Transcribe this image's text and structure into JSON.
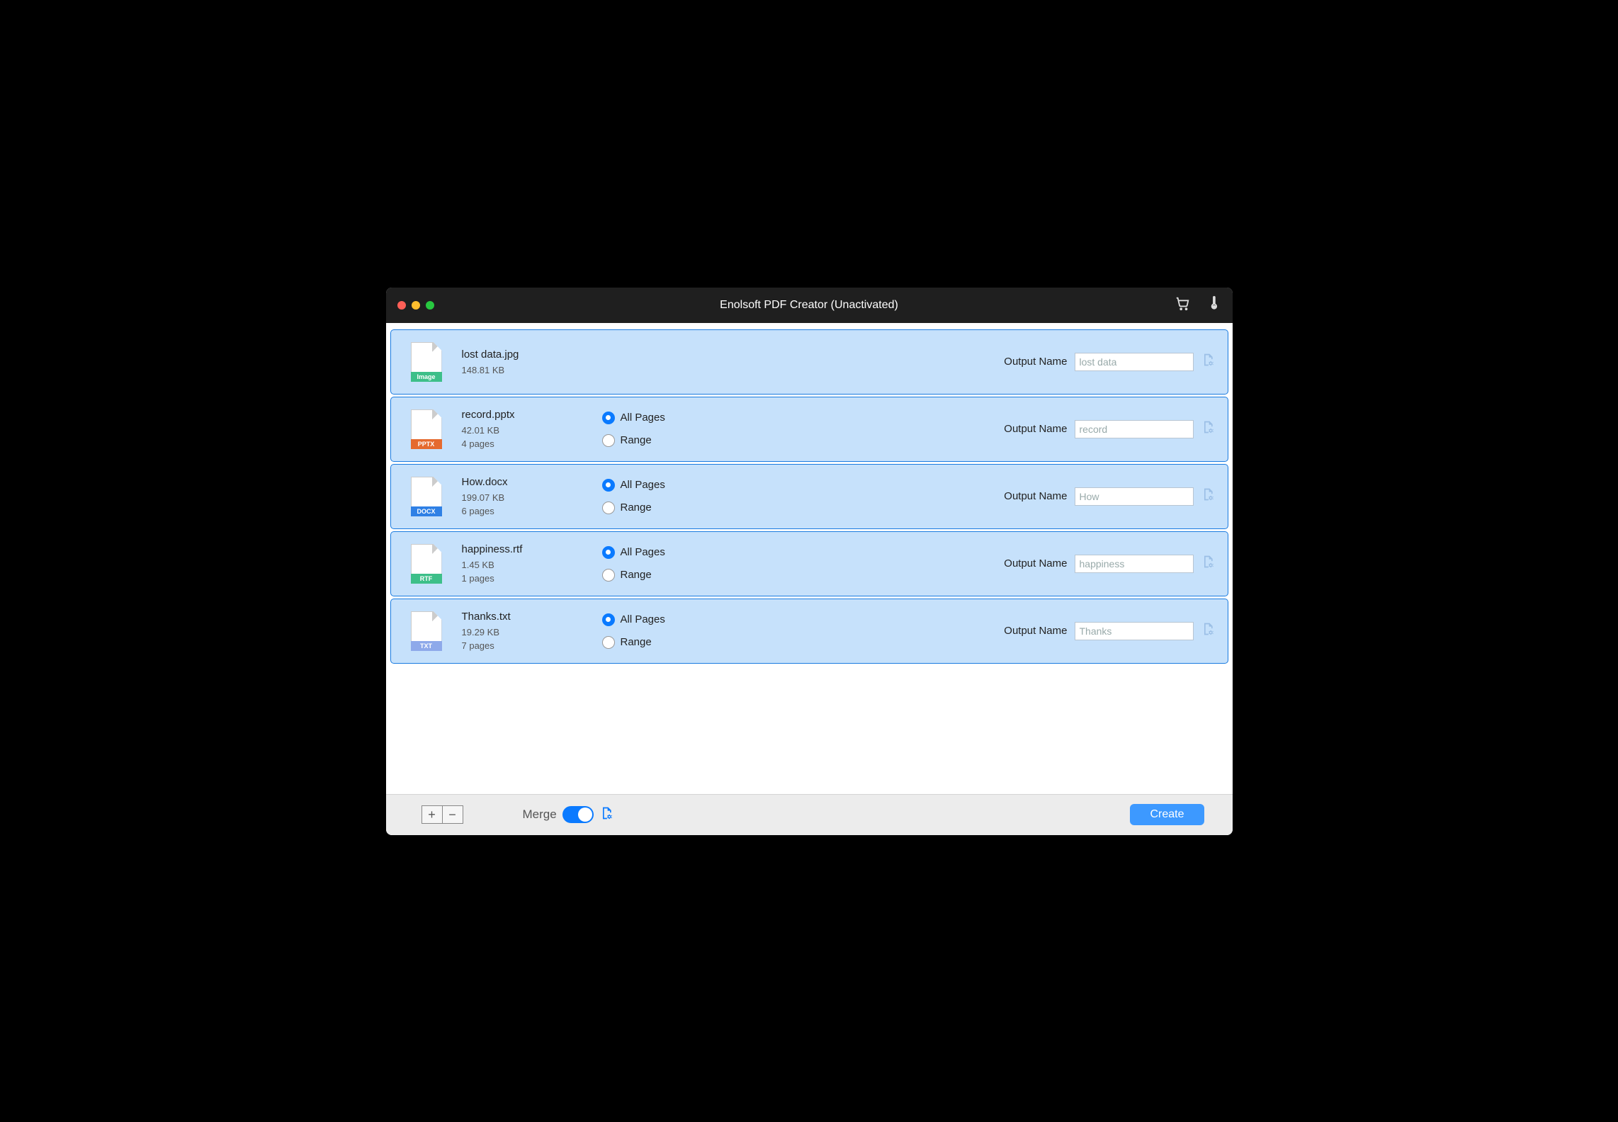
{
  "window": {
    "title": "Enolsoft PDF Creator (Unactivated)"
  },
  "labels": {
    "outputName": "Output Name",
    "allPages": "All Pages",
    "range": "Range",
    "merge": "Merge",
    "create": "Create"
  },
  "files": [
    {
      "name": "lost data.jpg",
      "size": "148.81 KB",
      "pages": null,
      "iconText": "Image",
      "iconClass": "fi-image",
      "output": "lost data",
      "hasPageOptions": false,
      "selAll": false
    },
    {
      "name": "record.pptx",
      "size": "42.01 KB",
      "pages": "4 pages",
      "iconText": "PPTX",
      "iconClass": "fi-pptx",
      "output": "record",
      "hasPageOptions": true,
      "selAll": true
    },
    {
      "name": "How.docx",
      "size": "199.07 KB",
      "pages": "6 pages",
      "iconText": "DOCX",
      "iconClass": "fi-docx",
      "output": "How",
      "hasPageOptions": true,
      "selAll": true
    },
    {
      "name": "happiness.rtf",
      "size": "1.45 KB",
      "pages": "1 pages",
      "iconText": "RTF",
      "iconClass": "fi-rtf",
      "output": "happiness",
      "hasPageOptions": true,
      "selAll": true
    },
    {
      "name": "Thanks.txt",
      "size": "19.29 KB",
      "pages": "7 pages",
      "iconText": "TXT",
      "iconClass": "fi-txt",
      "output": "Thanks",
      "hasPageOptions": true,
      "selAll": true
    }
  ],
  "mergeOn": true
}
